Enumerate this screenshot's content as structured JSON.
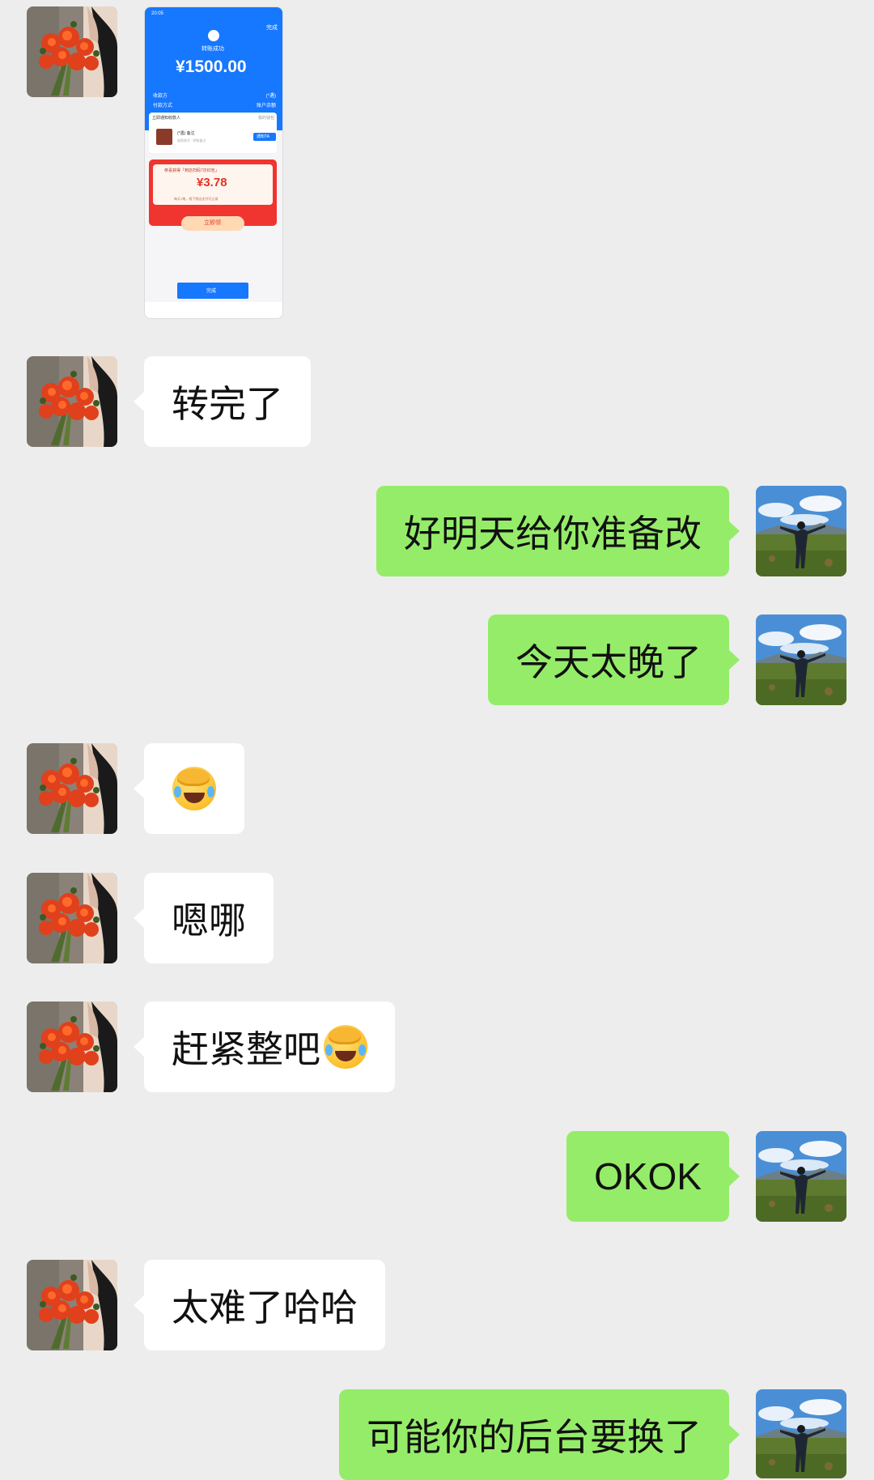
{
  "screenshot": {
    "status_time": "20:05",
    "done_top": "完成",
    "success_text": "转账成功",
    "amount": "¥1500.00",
    "payee_label": "收款方",
    "payee_value": "(*遇)",
    "method_label": "付款方式",
    "method_value": "账户余额",
    "notify_text": "立即通知收款人",
    "notify_right": "我的钱包",
    "notify_name": "(*遇) 备注",
    "notify_sub": "收款账号 · 转账备注",
    "notify_btn": "通知TA",
    "red_title": "恭喜获得「到店扫码7次红包」",
    "red_amount": "¥3.78",
    "red_sub": "每天1笔，线下到店支付可立减",
    "red_btn": "立即领",
    "done_btn": "完成"
  },
  "messages": [
    {
      "side": "in",
      "text": "转完了"
    },
    {
      "side": "out",
      "text": "好明天给你准备改"
    },
    {
      "side": "out",
      "text": "今天太晚了"
    },
    {
      "side": "in",
      "emoji": "face-with-hand-over-mouth-crying"
    },
    {
      "side": "in",
      "text": "嗯哪"
    },
    {
      "side": "in",
      "text": "赶紧整吧",
      "emoji": "face-with-hand-over-mouth-crying"
    },
    {
      "side": "out",
      "text": "OKOK"
    },
    {
      "side": "in",
      "text": "太难了哈哈"
    },
    {
      "side": "out",
      "text": "可能你的后台要换了"
    }
  ],
  "colors": {
    "background": "#ededed",
    "incoming_bubble": "#ffffff",
    "outgoing_bubble": "#95ec69",
    "alipay_blue": "#1677ff"
  },
  "avatars": {
    "incoming": "flower-bouquet-avatar",
    "outgoing": "landscape-person-avatar"
  }
}
